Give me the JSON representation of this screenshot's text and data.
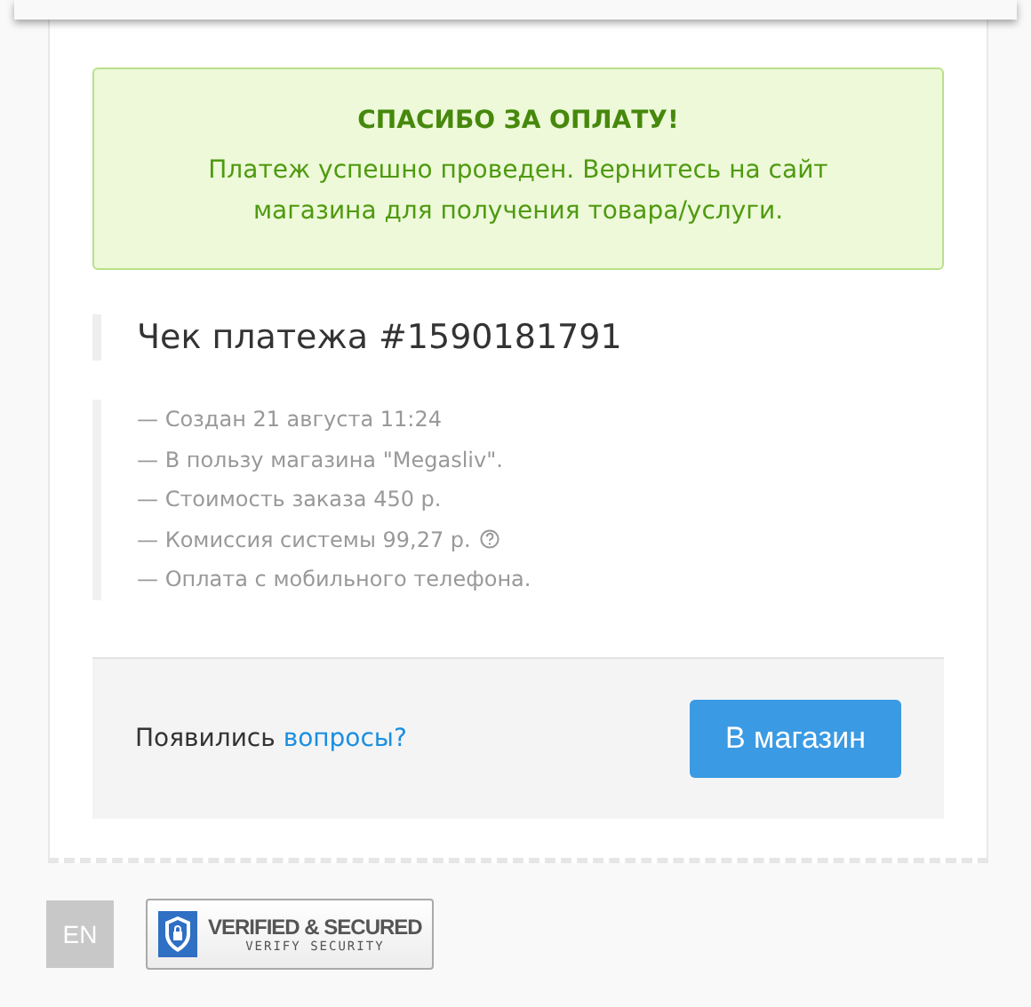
{
  "alert": {
    "title": "СПАСИБО ЗА ОПЛАТУ!",
    "message": "Платеж успешно проведен. Вернитесь на сайт магазина для получения товара/услуги."
  },
  "receipt": {
    "title": "Чек платежа #1590181791",
    "details": [
      {
        "text": "— Создан 21 августа 11:24",
        "help": false
      },
      {
        "text": "— В пользу магазина \"Megasliv\".",
        "help": false
      },
      {
        "text": "— Стоимость заказа 450 р.",
        "help": false
      },
      {
        "text": "— Комиссия системы 99,27 р.",
        "help": true
      },
      {
        "text": "— Оплата с мобильного телефона.",
        "help": false
      }
    ]
  },
  "footer": {
    "question": "Появились",
    "link": "вопросы?",
    "button": "В магазин"
  },
  "language": "EN",
  "badge": {
    "title": "VERIFIED & SECURED",
    "subtitle": "VERIFY SECURITY"
  }
}
